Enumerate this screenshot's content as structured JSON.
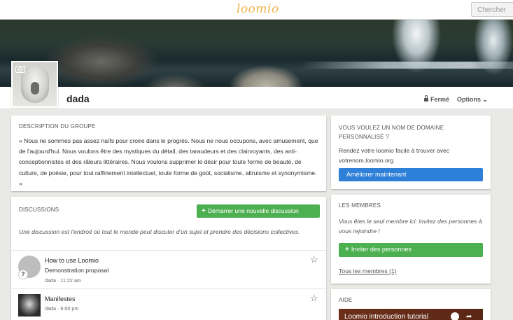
{
  "nav": {
    "logo": "loomio",
    "search_label": "Chercher"
  },
  "group": {
    "name": "dada",
    "privacy_label": "Fermé",
    "options_label": "Options ⌄"
  },
  "description": {
    "title": "DESCRIPTION DU GROUPE",
    "text": "« Nous ne sommes pas assez naïfs pour croire dans le progrès. Nous ne nous occupons, avec amusement, que de l'aujourd'hui. Nous voulons être des mystiques du détail, des taraudeurs et des clairvoyants, des anti-conceptionnistes et des râleurs littéraires. Nous voulons supprimer le désir pour toute forme de beauté, de culture, de poésie, pour tout raffinement intellectuel, toute forme de goût, socialisme, altruisme et synonymisme. »"
  },
  "discussions": {
    "title": "DISCUSSIONS",
    "start_button": "Démarrer une nouvelle discussion",
    "intro": "Une discussion est l'endroit où tout le monde peut discuter d'un sujet et prendre des décisions collectives.",
    "items": [
      {
        "title": "How to use Loomio",
        "subtitle": "Demonstration proposal",
        "meta": "dada · 11:22 am",
        "badge": "?"
      },
      {
        "title": "Manifestes",
        "meta": "dada · 6:00 pm"
      }
    ]
  },
  "domain": {
    "title": "VOUS VOULEZ UN NOM DE DOMAINE PERSONNALISÉ ?",
    "text": "Rendez votre loomio facile à trouver avec votrenom.loomio.org",
    "button": "Améliorer maintenant"
  },
  "members": {
    "title": "LES MEMBRES",
    "text": "Vous êtes le seul membre ici: invitez des personnes à vous rejoindre !",
    "invite_button": "Inviter des personnes",
    "all_link": "Tous les membres (1)"
  },
  "help": {
    "title": "AIDE",
    "video_title": "Loomio introduction tutorial"
  }
}
